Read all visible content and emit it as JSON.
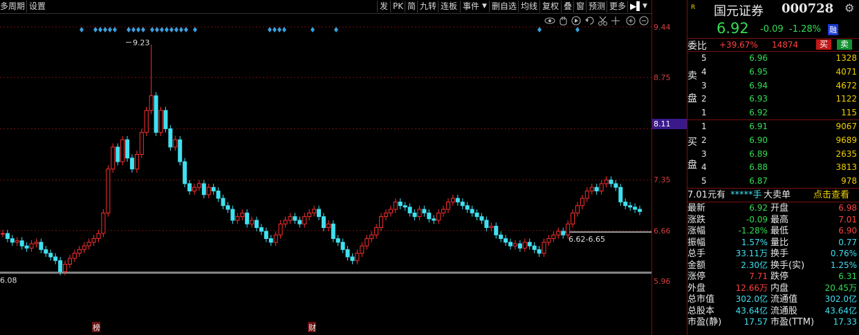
{
  "toolbar": {
    "left": [
      "多周期",
      "设置"
    ],
    "right": [
      "发",
      "PK",
      "简",
      "九转",
      "连板",
      "事件"
    ],
    "right2": [
      "删自选",
      "均线",
      "复权",
      "叠",
      "窗",
      "预测",
      "更多"
    ],
    "icons": [
      "eye-icon",
      "hand-icon",
      "reset-icon",
      "undo-icon",
      "scissors-icon",
      "zoom-in-icon",
      "zoom-out-icon"
    ]
  },
  "chart": {
    "yaxis_labels": [
      "9.44",
      "8.75",
      "7.35",
      "6.66",
      "5.96"
    ],
    "current_price_label": "8.11",
    "high_label": "9.23",
    "low_label": "6.08",
    "range_label": "6.62-6.65",
    "markers": [
      "榜",
      "财"
    ],
    "colors": {
      "up": "#ff3030",
      "down": "#40e0f0",
      "grid": "#7a1010",
      "diamond": "#3aa0e0"
    }
  },
  "panel": {
    "r_mark": "R",
    "name": "国元证券",
    "code": "000728",
    "price": "6.92",
    "change": "-0.09",
    "change_pct": "-1.28%",
    "tag": "融",
    "webi_label": "委比",
    "webi_pct": "+39.67%",
    "webi_num": "14874",
    "buy_btn": "买",
    "sell_btn": "卖",
    "sell_side_label": "卖盘",
    "buy_side_label": "买盘",
    "asks": [
      {
        "lvl": "5",
        "price": "6.96",
        "vol": "1328"
      },
      {
        "lvl": "4",
        "price": "6.95",
        "vol": "4071"
      },
      {
        "lvl": "3",
        "price": "6.94",
        "vol": "4672"
      },
      {
        "lvl": "2",
        "price": "6.93",
        "vol": "1122"
      },
      {
        "lvl": "1",
        "price": "6.92",
        "vol": "115"
      }
    ],
    "bids": [
      {
        "lvl": "1",
        "price": "6.91",
        "vol": "9067"
      },
      {
        "lvl": "2",
        "price": "6.90",
        "vol": "9689"
      },
      {
        "lvl": "3",
        "price": "6.89",
        "vol": "2635"
      },
      {
        "lvl": "4",
        "price": "6.88",
        "vol": "3813"
      },
      {
        "lvl": "5",
        "price": "6.87",
        "vol": "978"
      }
    ],
    "bigorder": {
      "a": "7.01元有",
      "b": "*****手",
      "c": "大卖单",
      "d": "点击查看"
    },
    "stats": [
      {
        "k1": "最新",
        "v1": "6.92",
        "k2": "开盘",
        "v2": "6.98"
      },
      {
        "k1": "涨跌",
        "v1": "-0.09",
        "k2": "最高",
        "v2": "7.01"
      },
      {
        "k1": "涨幅",
        "v1": "-1.28%",
        "k2": "最低",
        "v2": "6.90"
      },
      {
        "k1": "振幅",
        "v1": "1.57%",
        "k2": "量比",
        "v2": "0.77"
      },
      {
        "k1": "总手",
        "v1": "33.11万",
        "k2": "换手",
        "v2": "0.76%"
      },
      {
        "k1": "金额",
        "v1": "2.30亿",
        "k2": "换手(实)",
        "v2": "1.25%"
      },
      {
        "k1": "涨停",
        "v1": "7.71",
        "k2": "跌停",
        "v2": "6.31"
      },
      {
        "k1": "外盘",
        "v1": "12.66万",
        "k2": "内盘",
        "v2": "20.45万"
      },
      {
        "k1": "总市值",
        "v1": "302.0亿",
        "k2": "流通值",
        "v2": "302.0亿"
      },
      {
        "k1": "总股本",
        "v1": "43.64亿",
        "k2": "流通股",
        "v2": "43.64亿"
      },
      {
        "k1": "市盈(静)",
        "v1": "17.57",
        "k2": "市盈(TTM)",
        "v2": "17.33"
      }
    ]
  }
}
